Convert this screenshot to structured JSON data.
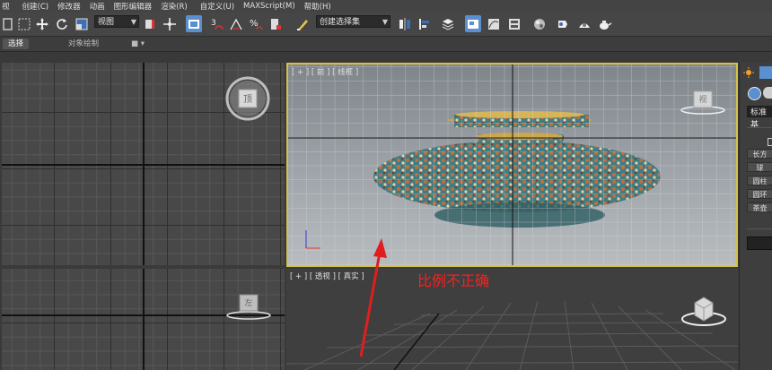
{
  "menu": [
    "视",
    "创建(C)",
    "修改器",
    "动画",
    "图形编辑器",
    "渲染(R)",
    "自定义(U)",
    "MAXScript(M)",
    "帮助(H)"
  ],
  "toolbar": {
    "view_dropdown": "视图",
    "selection_set_dropdown": "创建选择集",
    "snap_label": "3",
    "percent_snap_label": "%"
  },
  "ribbon": {
    "tabs": [
      "选择",
      "对象绘制"
    ],
    "active_tab": 0
  },
  "viewports": {
    "top_left": {
      "label": "",
      "cube_label": "顶"
    },
    "front": {
      "label": "[ + ] [ 前 ] [ 线框 ]",
      "cube_label": "视"
    },
    "left": {
      "label": "",
      "cube_label": "左"
    },
    "perspective": {
      "label": "[ + ] [ 透视 ] [ 真实 ]"
    }
  },
  "command_panel": {
    "dropdown": "标准基",
    "buttons": [
      "长方",
      "球",
      "圆柱",
      "圆环",
      "茶壶"
    ]
  },
  "annotation": {
    "text": "比例不正确",
    "color": "#ff1e1e"
  },
  "colors": {
    "accent": "#5a8fd0",
    "front_viewport_border": "#d4c14a"
  }
}
